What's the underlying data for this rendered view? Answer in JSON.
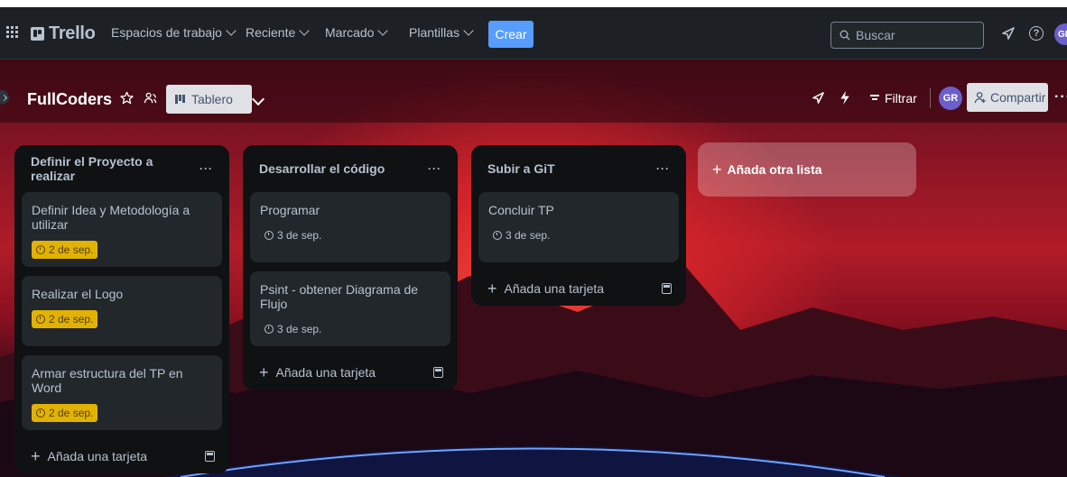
{
  "app": {
    "name": "Trello"
  },
  "nav": {
    "workspaces": "Espacios de trabajo",
    "recent": "Reciente",
    "starred": "Marcado",
    "templates": "Plantillas",
    "create": "Crear",
    "search_placeholder": "Buscar",
    "avatar_initials": "GR"
  },
  "board": {
    "title": "FullCoders",
    "view_label": "Tablero",
    "filter_label": "Filtrar",
    "member_initials": "GR",
    "share_label": "Compartir",
    "add_list_label": "Añada otra lista"
  },
  "lists": [
    {
      "title": "Definir el Proyecto a realizar",
      "cards": [
        {
          "title": "Definir Idea y Metodología a utilizar",
          "due": "2 de sep."
        },
        {
          "title": "Realizar el Logo",
          "due": "2 de sep."
        },
        {
          "title": "Armar estructura del TP en Word",
          "due": "2 de sep."
        }
      ],
      "add_card_label": "Añada una tarjeta"
    },
    {
      "title": "Desarrollar el código",
      "cards": [
        {
          "title": "Programar",
          "due": "3 de sep."
        },
        {
          "title": "Psint - obtener Diagrama de Flujo",
          "due": "3 de sep."
        }
      ],
      "add_card_label": "Añada una tarjeta"
    },
    {
      "title": "Subir a GiT",
      "cards": [
        {
          "title": "Concluir TP",
          "due": "3 de sep."
        }
      ],
      "add_card_label": "Añada una tarjeta"
    }
  ],
  "colors": {
    "nav_bg": "#1d2125",
    "create_button": "#579dff",
    "list_bg": "#0f1113",
    "card_bg": "#22272b",
    "due_warning": "#e2b203",
    "avatar": "#6b5fce"
  },
  "icons": [
    "apps-grid-icon",
    "trello-logo-icon",
    "search-icon",
    "notifications-icon",
    "help-icon",
    "star-icon",
    "visibility-icon",
    "board-icon",
    "power-ups-icon",
    "automation-icon",
    "filter-icon",
    "share-icon",
    "clock-icon",
    "template-icon",
    "plus-icon",
    "more-icon"
  ]
}
